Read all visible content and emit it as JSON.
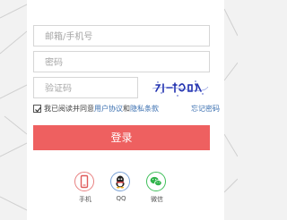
{
  "form": {
    "account_placeholder": "邮箱/手机号",
    "password_placeholder": "密码",
    "captcha_placeholder": "验证码",
    "agree_prefix": "我已阅读并同意",
    "user_agreement": "用户协议",
    "agree_and": "和",
    "privacy_policy": "隐私条款",
    "forgot_password": "忘记密码",
    "agree_checked": true,
    "login_label": "登录"
  },
  "social": {
    "phone_label": "手机",
    "qq_label": "QQ",
    "wechat_label": "微信"
  },
  "colors": {
    "login_button": "#ee6060",
    "link": "#3a6fb0",
    "phone_icon": "#e05a5a",
    "qq_icon": "#3b6cc0",
    "wechat_icon": "#2fb34a"
  },
  "icons": {
    "checkbox": "checkmark-icon",
    "phone": "phone-icon",
    "qq": "qq-penguin-icon",
    "wechat": "wechat-icon"
  }
}
